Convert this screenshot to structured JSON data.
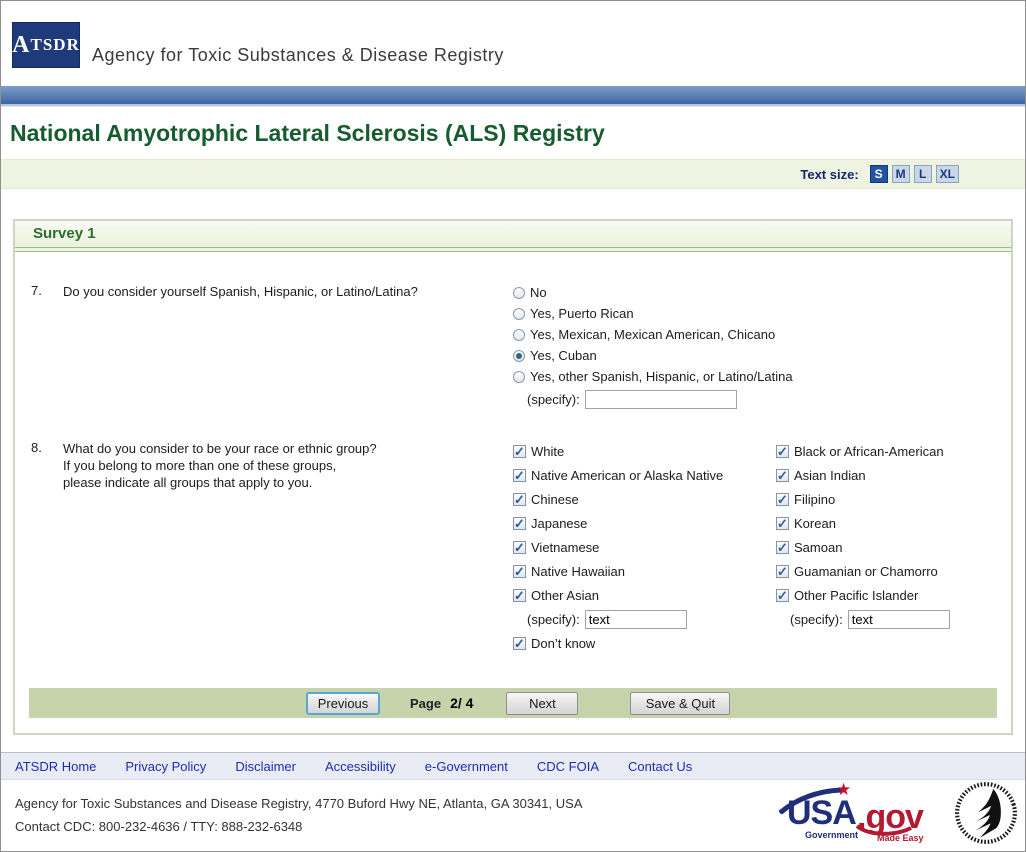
{
  "header": {
    "logo_text": "ATSDR",
    "agency_name": "Agency for Toxic Substances & Disease Registry"
  },
  "page_title": "National Amyotrophic Lateral Sclerosis (ALS) Registry",
  "text_size": {
    "label": "Text size:",
    "options": [
      "S",
      "M",
      "L",
      "XL"
    ],
    "selected": "S"
  },
  "survey": {
    "title": "Survey 1",
    "q7": {
      "number": "7.",
      "text": "Do you consider yourself Spanish, Hispanic, or Latino/Latina?",
      "options": [
        {
          "label": "No",
          "selected": false
        },
        {
          "label": "Yes, Puerto Rican",
          "selected": false
        },
        {
          "label": "Yes, Mexican, Mexican American, Chicano",
          "selected": false
        },
        {
          "label": "Yes, Cuban",
          "selected": true
        },
        {
          "label": "Yes, other Spanish, Hispanic, or Latino/Latina",
          "selected": false
        }
      ],
      "specify_label": "(specify):",
      "specify_value": ""
    },
    "q8": {
      "number": "8.",
      "line1": "What do you consider to be your race or ethnic group?",
      "line2": "If you belong to more than one of these groups,",
      "line3": "please indicate all groups that apply to you.",
      "left": {
        "items": [
          "White",
          "Native American or Alaska Native",
          "Chinese",
          "Japanese",
          "Vietnamese",
          "Native Hawaiian",
          "Other Asian"
        ],
        "checked": [
          true,
          true,
          true,
          true,
          true,
          true,
          true
        ],
        "specify_label": "(specify):",
        "specify_value": "text",
        "last_item": "Don’t know",
        "last_checked": true
      },
      "right": {
        "items": [
          "Black or African-American",
          "Asian Indian",
          "Filipino",
          "Korean",
          "Samoan",
          "Guamanian or Chamorro",
          "Other Pacific Islander"
        ],
        "checked": [
          true,
          true,
          true,
          true,
          true,
          true,
          true
        ],
        "specify_label": "(specify):",
        "specify_value": "text"
      }
    }
  },
  "pagination": {
    "previous_label": "Previous",
    "page_label": "Page",
    "page_value": "2/ 4",
    "next_label": "Next",
    "save_quit_label": "Save & Quit"
  },
  "footer_links": [
    "ATSDR Home",
    "Privacy Policy",
    "Disclaimer",
    "Accessibility",
    "e-Government",
    "CDC FOIA",
    "Contact Us"
  ],
  "footer": {
    "address": "Agency for Toxic Substances and Disease Registry, 4770 Buford Hwy NE, Atlanta, GA 30341, USA",
    "contact": "Contact CDC: 800-232-4636 / TTY: 888-232-6348",
    "usa_gov": {
      "usa": "USA",
      "gov": ".gov",
      "tagline_left": "Government",
      "tagline_right": "Made Easy"
    }
  },
  "colors": {
    "header_bar_blue_top": "#7d9dc8",
    "header_bar_blue_bottom": "#3d63a3",
    "title_green": "#165c2e",
    "survey_header_green": "#2c6e2c",
    "nav_bar_green": "#c6d3ab",
    "link_blue": "#1b2db0",
    "size_selected_bg": "#2353a5",
    "logo_navy": "#1e3a7a",
    "usagov_red": "#b21a32"
  }
}
